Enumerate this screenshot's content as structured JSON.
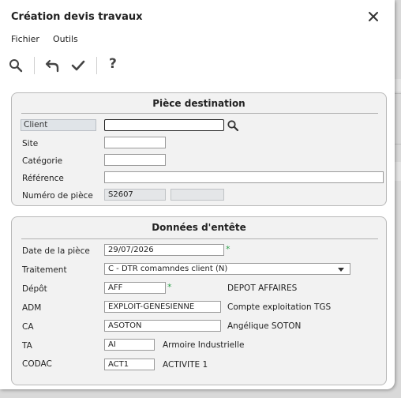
{
  "window": {
    "title": "Création devis travaux"
  },
  "menu": {
    "file": "Fichier",
    "tools": "Outils"
  },
  "toolbar": {
    "help": "?"
  },
  "destination": {
    "title": "Pièce destination",
    "client_label": "Client",
    "client_value": "",
    "site_label": "Site",
    "categorie_label": "Catégorie",
    "reference_label": "Référence",
    "numero_label": "Numéro de pièce",
    "numero_value": "S2607"
  },
  "entete": {
    "title": "Données d'entête",
    "date_label": "Date de la pièce",
    "date_value": "29/07/2026",
    "traitement_label": "Traitement",
    "traitement_value": "C  - DTR comamndes client (N)",
    "depot_label": "Dépôt",
    "depot_value": "AFF",
    "depot_desc": "DEPOT AFFAIRES",
    "adm_label": "ADM",
    "adm_value": "EXPLOIT-GENESIENNE",
    "adm_desc": "Compte exploitation TGS",
    "ca_label": "CA",
    "ca_value": "ASOTON",
    "ca_desc": "Angélique SOTON",
    "ta_label": "TA",
    "ta_value": "AI",
    "ta_desc": "Armoire Industrielle",
    "codac_label": "CODAC",
    "codac_value": "ACT1",
    "codac_desc": "ACTIVITE 1",
    "required_mark": "*"
  },
  "colors": {
    "required": "#2ea04a",
    "group_bg": "#f2f2f2"
  }
}
